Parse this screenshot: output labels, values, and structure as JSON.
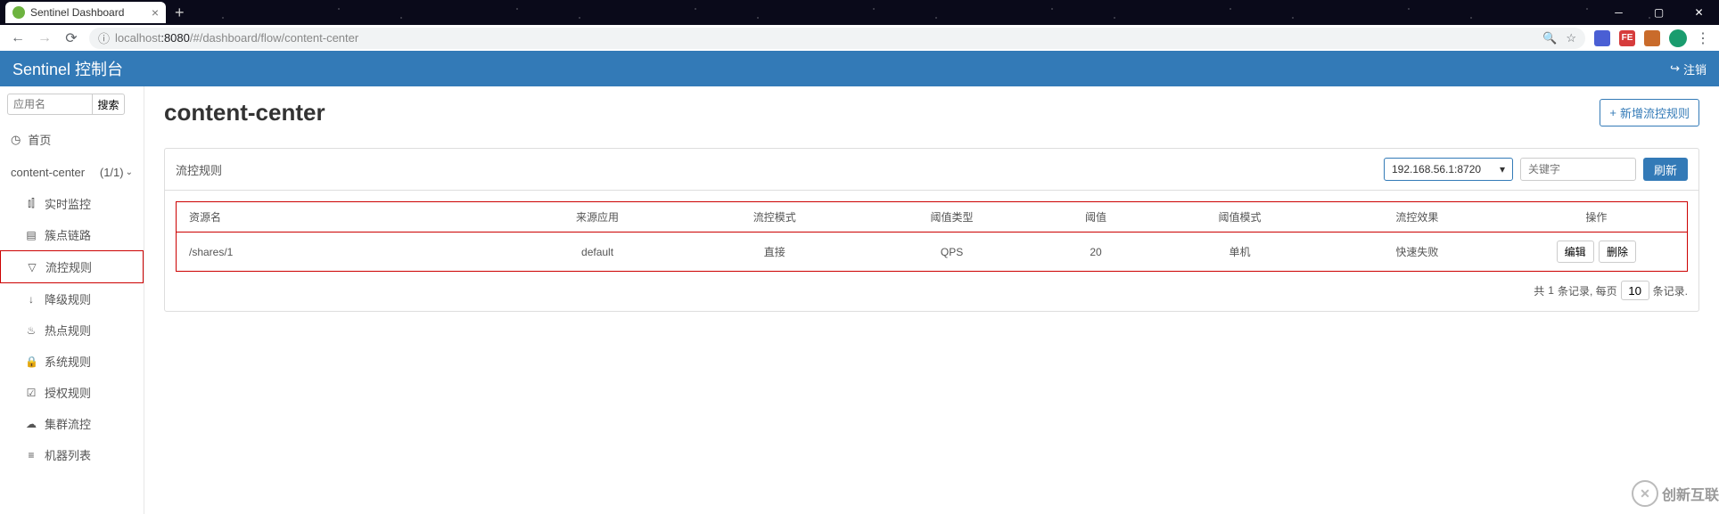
{
  "browser": {
    "tab_title": "Sentinel Dashboard",
    "url_host_dim": "localhost",
    "url_port": ":8080",
    "url_path": "/#/dashboard/flow/content-center"
  },
  "header": {
    "title": "Sentinel 控制台",
    "logout_label": "注销"
  },
  "sidebar": {
    "search_placeholder": "应用名",
    "search_btn": "搜索",
    "home_label": "首页",
    "app_name": "content-center",
    "app_count": "(1/1)",
    "items": [
      {
        "icon": "chart",
        "label": "实时监控"
      },
      {
        "icon": "link",
        "label": "簇点链路"
      },
      {
        "icon": "filter",
        "label": "流控规则"
      },
      {
        "icon": "down",
        "label": "降级规则"
      },
      {
        "icon": "fire",
        "label": "热点规则"
      },
      {
        "icon": "lock",
        "label": "系统规则"
      },
      {
        "icon": "check",
        "label": "授权规则"
      },
      {
        "icon": "cloud",
        "label": "集群流控"
      },
      {
        "icon": "list",
        "label": "机器列表"
      }
    ]
  },
  "page": {
    "title": "content-center",
    "add_btn": "新增流控规则",
    "panel_title": "流控规则",
    "machine_selected": "192.168.56.1:8720",
    "keyword_placeholder": "关键字",
    "refresh_btn": "刷新",
    "columns": [
      "资源名",
      "来源应用",
      "流控模式",
      "阈值类型",
      "阈值",
      "阈值模式",
      "流控效果",
      "操作"
    ],
    "rows": [
      {
        "resource": "/shares/1",
        "origin": "default",
        "mode": "直接",
        "threshold_type": "QPS",
        "threshold": "20",
        "threshold_mode": "单机",
        "effect": "快速失败"
      }
    ],
    "row_edit": "编辑",
    "row_delete": "删除",
    "pager_prefix": "共 ",
    "pager_count": "1",
    "pager_mid": " 条记录, 每页 ",
    "pager_size": "10",
    "pager_suffix": " 条记录."
  },
  "watermark": "创新互联"
}
